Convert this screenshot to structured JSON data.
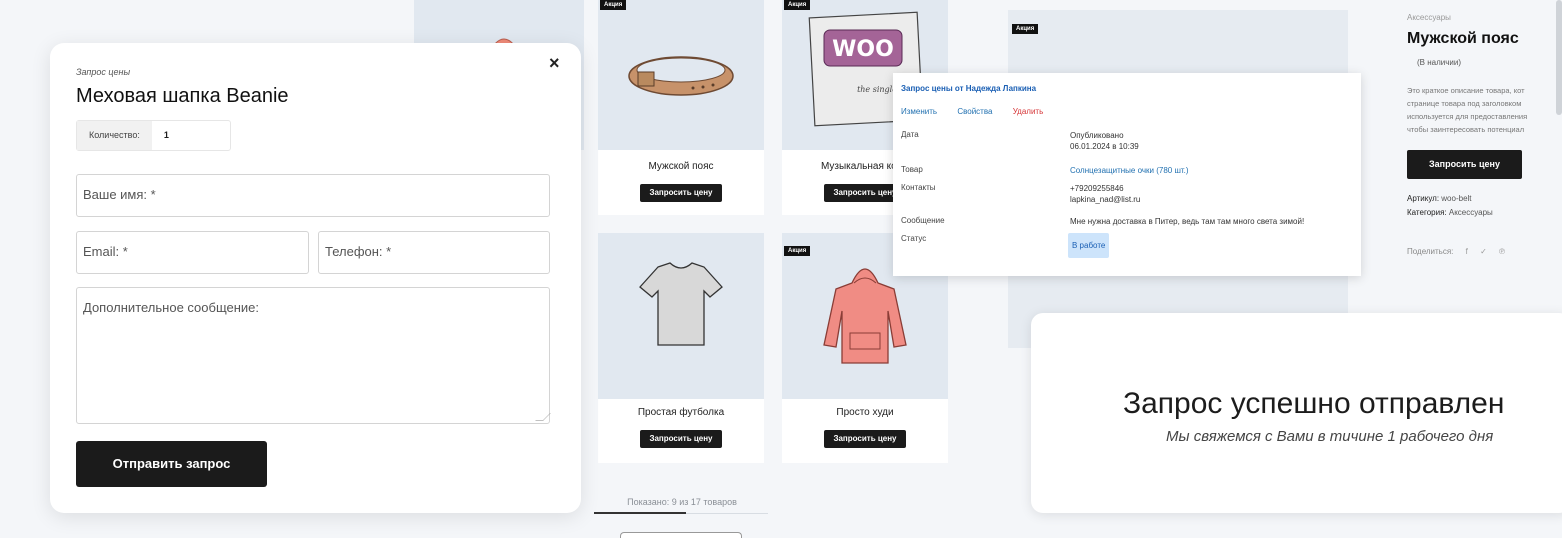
{
  "grid": {
    "sale_badge": "Акция",
    "products": [
      {
        "title": "Мужской пояс",
        "button": "Запросить цену"
      },
      {
        "title": "Музыкальная комп",
        "button": "Запросить цену"
      },
      {
        "title": "Простая футболка",
        "button": "Запросить цену"
      },
      {
        "title": "Просто худи",
        "button": "Запросить цену"
      }
    ],
    "woo_text": "WOO",
    "woo_subtext": "the single",
    "showing": "Показано: 9 из 17 товаров"
  },
  "product": {
    "sale_badge": "Акция",
    "category": "Аксессуары",
    "title": "Мужской пояс",
    "stock": "(В наличии)",
    "description_lines": [
      "Это краткое описание товара, кот",
      "странице товара под заголовком",
      "используется для предоставления",
      "чтобы заинтересовать потенциал"
    ],
    "button": "Запросить цену",
    "sku_label": "Артикул:",
    "sku": "woo-belt",
    "category_label": "Категория:",
    "category_value": "Аксессуары",
    "share_label": "Поделиться:",
    "share_icons": [
      "f",
      "✓",
      "℗"
    ]
  },
  "admin": {
    "title": "Запрос цены от Надежда Лапкина",
    "actions": {
      "edit": "Изменить",
      "props": "Свойства",
      "delete": "Удалить"
    },
    "rows": {
      "date_label": "Дата",
      "date_value_1": "Опубликовано",
      "date_value_2": "06.01.2024 в 10:39",
      "product_label": "Товар",
      "product_value": "Солнцезащитные очки (780 шт.)",
      "contacts_label": "Контакты",
      "phone": "+79209255846",
      "email": "lapkina_nad@list.ru",
      "message_label": "Сообщение",
      "message_value": "Мне нужна доставка в Питер, ведь там там много света зимой!",
      "status_label": "Статус",
      "status_value": "В работе"
    }
  },
  "success": {
    "title": "Запрос успешно отправлен",
    "subtitle": "Мы свяжемся с Вами в тичине 1 рабочего дня"
  },
  "modal": {
    "close": "×",
    "subtitle": "Запрос цены",
    "title": "Меховая шапка Beanie",
    "qty_label": "Количество:",
    "qty_value": "1",
    "name_placeholder": "Ваше имя: *",
    "email_placeholder": "Email: *",
    "phone_placeholder": "Телефон: *",
    "message_placeholder": "Дополнительное сообщение:",
    "submit": "Отправить запрос"
  }
}
